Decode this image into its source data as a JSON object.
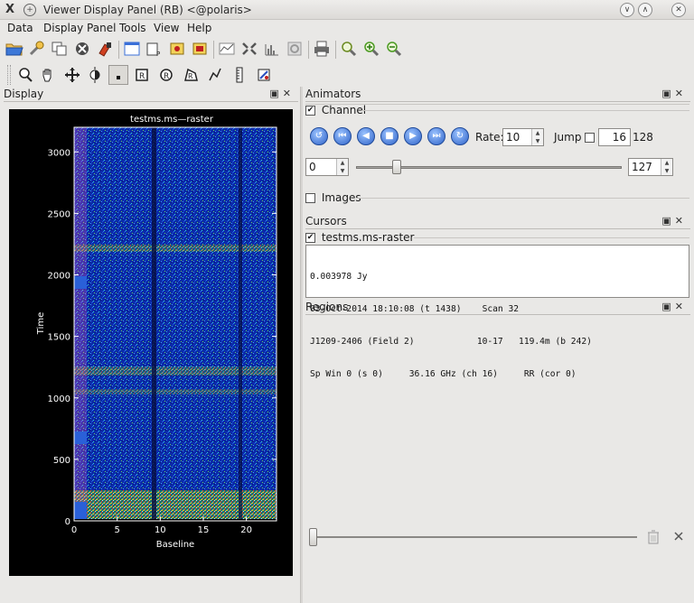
{
  "window": {
    "title": "Viewer Display Panel (RB) <@polaris>",
    "app_glyph": "X",
    "pin_glyph": "+",
    "btn_min": "∨",
    "btn_max": "∧",
    "btn_close": "✕"
  },
  "menu": {
    "items": [
      {
        "label": "Data"
      },
      {
        "label": "Display Panel"
      },
      {
        "label": "Tools"
      },
      {
        "label": "View"
      },
      {
        "label": "Help"
      }
    ]
  },
  "display_panel": {
    "title": "Display",
    "float_glyph": "▣",
    "close_glyph": "✕",
    "plot": {
      "title": "testms.ms—raster",
      "xlabel": "Baseline",
      "ylabel": "Time",
      "x_ticks": [
        "0",
        "5",
        "10",
        "15",
        "20"
      ],
      "y_ticks": [
        "0",
        "500",
        "1000",
        "1500",
        "2000",
        "2500",
        "3000"
      ]
    }
  },
  "animators": {
    "title": "Animators",
    "channel": {
      "checked": true,
      "label": "Channel",
      "rate_label": "Rate:",
      "rate_value": "10",
      "jump_label": "Jump",
      "jump_value": "16",
      "jump_total": "128",
      "frame_start": "0",
      "frame_end": "127",
      "slider_pos": 0.14
    },
    "images": {
      "checked": false,
      "label": "Images"
    },
    "nav_glyphs": [
      "↺",
      "⏮",
      "◀",
      "■",
      "▶",
      "⏭",
      "↻"
    ]
  },
  "cursors": {
    "title": "Cursors",
    "layer": {
      "checked": true,
      "label": "testms.ms-raster"
    },
    "lines": [
      "0.003978 Jy",
      "03-Oct-2014 18:10:08 (t 1438)    Scan 32",
      "J1209-2406 (Field 2)            10-17   119.4m (b 242)",
      "Sp Win 0 (s 0)     36.16 GHz (ch 16)     RR (cor 0)"
    ]
  },
  "regions": {
    "title": "Regions",
    "slider_pos": 0.0
  },
  "colors": {
    "raster_base": "#0a1f9e",
    "raster_hot": "#ffd400",
    "nav_button": "#3a6fd8"
  }
}
